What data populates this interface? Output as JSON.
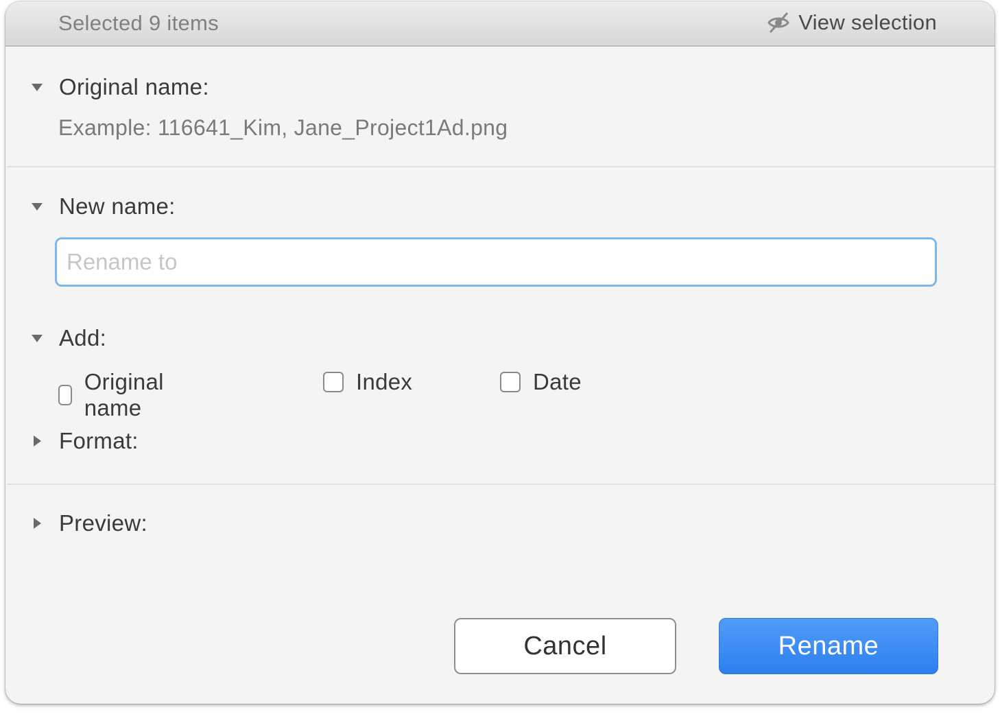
{
  "titlebar": {
    "title": "Selected 9 items",
    "view_selection_label": "View selection",
    "view_selection_icon": "eye-slash-icon"
  },
  "sections": {
    "original": {
      "label": "Original name:",
      "expanded": true,
      "example": "Example: 116641_Kim, Jane_Project1Ad.png"
    },
    "new_name": {
      "label": "New name:",
      "expanded": true,
      "input_value": "",
      "input_placeholder": "Rename to"
    },
    "add": {
      "label": "Add:",
      "expanded": true,
      "options": [
        {
          "label": "Original name",
          "checked": false
        },
        {
          "label": "Index",
          "checked": false
        },
        {
          "label": "Date",
          "checked": false
        }
      ]
    },
    "format": {
      "label": "Format:",
      "expanded": false
    },
    "preview": {
      "label": "Preview:",
      "expanded": false
    }
  },
  "buttons": {
    "cancel_label": "Cancel",
    "rename_label": "Rename"
  },
  "colors": {
    "accent": "#3A86F2",
    "focus_ring": "#7EB6F1",
    "background": "#F4F4F4"
  }
}
